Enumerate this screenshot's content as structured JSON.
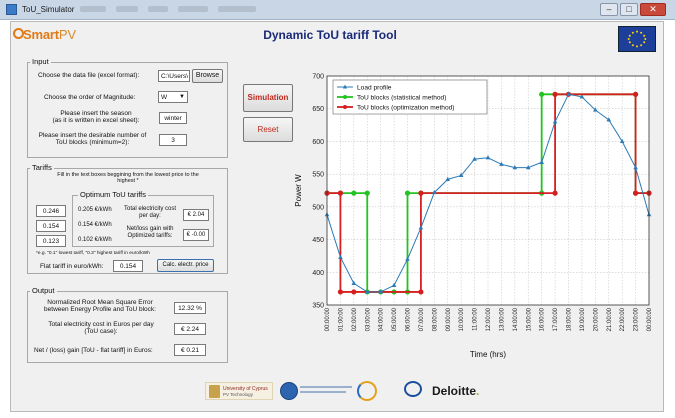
{
  "window": {
    "title": "ToU_Simulator",
    "min": "–",
    "max": "□",
    "close": "✕"
  },
  "brand": {
    "logo_main": "Smart",
    "logo_tail": "PV"
  },
  "header": {
    "title": "Dynamic ToU tariff Tool"
  },
  "input": {
    "panel_title": "Input",
    "data_file_label": "Choose the data file (excel format):",
    "data_file_value": "C:\\Users\\",
    "browse_label": "Browse",
    "magnitude_label": "Choose the order of Magnitude:",
    "magnitude_value": "W",
    "season_label_1": "Please insert the season",
    "season_label_2": "(as it is written in excel sheet):",
    "season_value": "winter",
    "blocks_label_1": "Please insert the desirable number of",
    "blocks_label_2": "ToU blocks (minimum=2):",
    "blocks_value": "3"
  },
  "tariffs": {
    "panel_title": "Tariffs",
    "instruction_1": "Fill in the text boxes beggining from the lowest price to the",
    "instruction_2": "highest *",
    "optimum_title": "Optimum ToU tariffs",
    "prices_entered": [
      "0.246",
      "0.154",
      "0.123"
    ],
    "prices_optimum": [
      "0.205 €/kWh",
      "0.154 €/kWh",
      "0.102 €/kWh"
    ],
    "total_cost_label_1": "Total electricity cost",
    "total_cost_label_2": "per day:",
    "total_cost_value": "€ 2.04",
    "net_gain_label_1": "Net/loss gain with",
    "net_gain_label_2": "Optimized tariffs:",
    "net_gain_value": "€ -0.00",
    "footnote": "*e.g. \"0.1\" lowest tariff, \"0.3\" highest tariff in euro/kWh",
    "flat_label": "Flat tariff in euro/kWh:",
    "flat_value": "0.154",
    "calc_button": "Calc. electr. price"
  },
  "output": {
    "panel_title": "Output",
    "nrmse_label_1": "Normalized Root Mean Square Error",
    "nrmse_label_2": "between Energy Profile and ToU block:",
    "nrmse_value": "12.32 %",
    "cost_label_1": "Total electricity cost in Euros per day",
    "cost_label_2": "(ToU case):",
    "cost_value": "€ 2.24",
    "gain_label": "Net / (loss) gain [ToU - flat tariff] in Euros:",
    "gain_value": "€ 0.21"
  },
  "actions": {
    "simulation": "Simulation",
    "reset": "Reset"
  },
  "footer": {
    "ucy_1": "University of Cyprus",
    "ucy_2": "PV Technology",
    "deloitte": "Deloitte",
    "deloitte_dot": "."
  },
  "colors": {
    "load": "#2c7bb6",
    "statistical": "#22c322",
    "optimization": "#d61f1f"
  },
  "chart_data": {
    "type": "line",
    "xlabel": "Time (hrs)",
    "ylabel": "Power W",
    "ylim": [
      350,
      700
    ],
    "yticks": [
      350,
      400,
      450,
      500,
      550,
      600,
      650,
      700
    ],
    "x": [
      "00:00:00",
      "01:00:00",
      "02:00:00",
      "03:00:00",
      "04:00:00",
      "05:00:00",
      "06:00:00",
      "07:00:00",
      "08:00:00",
      "09:00:00",
      "10:00:00",
      "11:00:00",
      "12:00:00",
      "13:00:00",
      "14:00:00",
      "15:00:00",
      "16:00:00",
      "17:00:00",
      "18:00:00",
      "19:00:00",
      "20:00:00",
      "21:00:00",
      "22:00:00",
      "23:00:00",
      "00:00:00"
    ],
    "grid": true,
    "legend": "top-left",
    "series": [
      {
        "name": "Load profile",
        "values": [
          488,
          423,
          383,
          370,
          370,
          380,
          420,
          468,
          522,
          542,
          548,
          573,
          575,
          565,
          560,
          560,
          568,
          630,
          672,
          668,
          648,
          633,
          600,
          560,
          488
        ]
      },
      {
        "name": "ToU blocks (statistical method)",
        "step_points": [
          [
            0,
            521
          ],
          [
            1,
            521
          ],
          [
            1,
            521
          ],
          [
            2,
            521
          ],
          [
            2,
            521
          ],
          [
            3,
            521
          ],
          [
            3,
            370
          ],
          [
            4,
            370
          ],
          [
            5,
            370
          ],
          [
            6,
            370
          ],
          [
            6,
            521
          ],
          [
            7,
            521
          ],
          [
            16,
            521
          ],
          [
            16,
            672
          ],
          [
            17,
            672
          ],
          [
            23,
            672
          ],
          [
            23,
            521
          ],
          [
            24,
            521
          ]
        ]
      },
      {
        "name": "ToU blocks (optimization method)",
        "step_points": [
          [
            0,
            521
          ],
          [
            1,
            521
          ],
          [
            1,
            370
          ],
          [
            2,
            370
          ],
          [
            7,
            370
          ],
          [
            7,
            521
          ],
          [
            17,
            521
          ],
          [
            17,
            672
          ],
          [
            18,
            672
          ],
          [
            23,
            672
          ],
          [
            23,
            521
          ],
          [
            24,
            521
          ]
        ]
      }
    ]
  }
}
